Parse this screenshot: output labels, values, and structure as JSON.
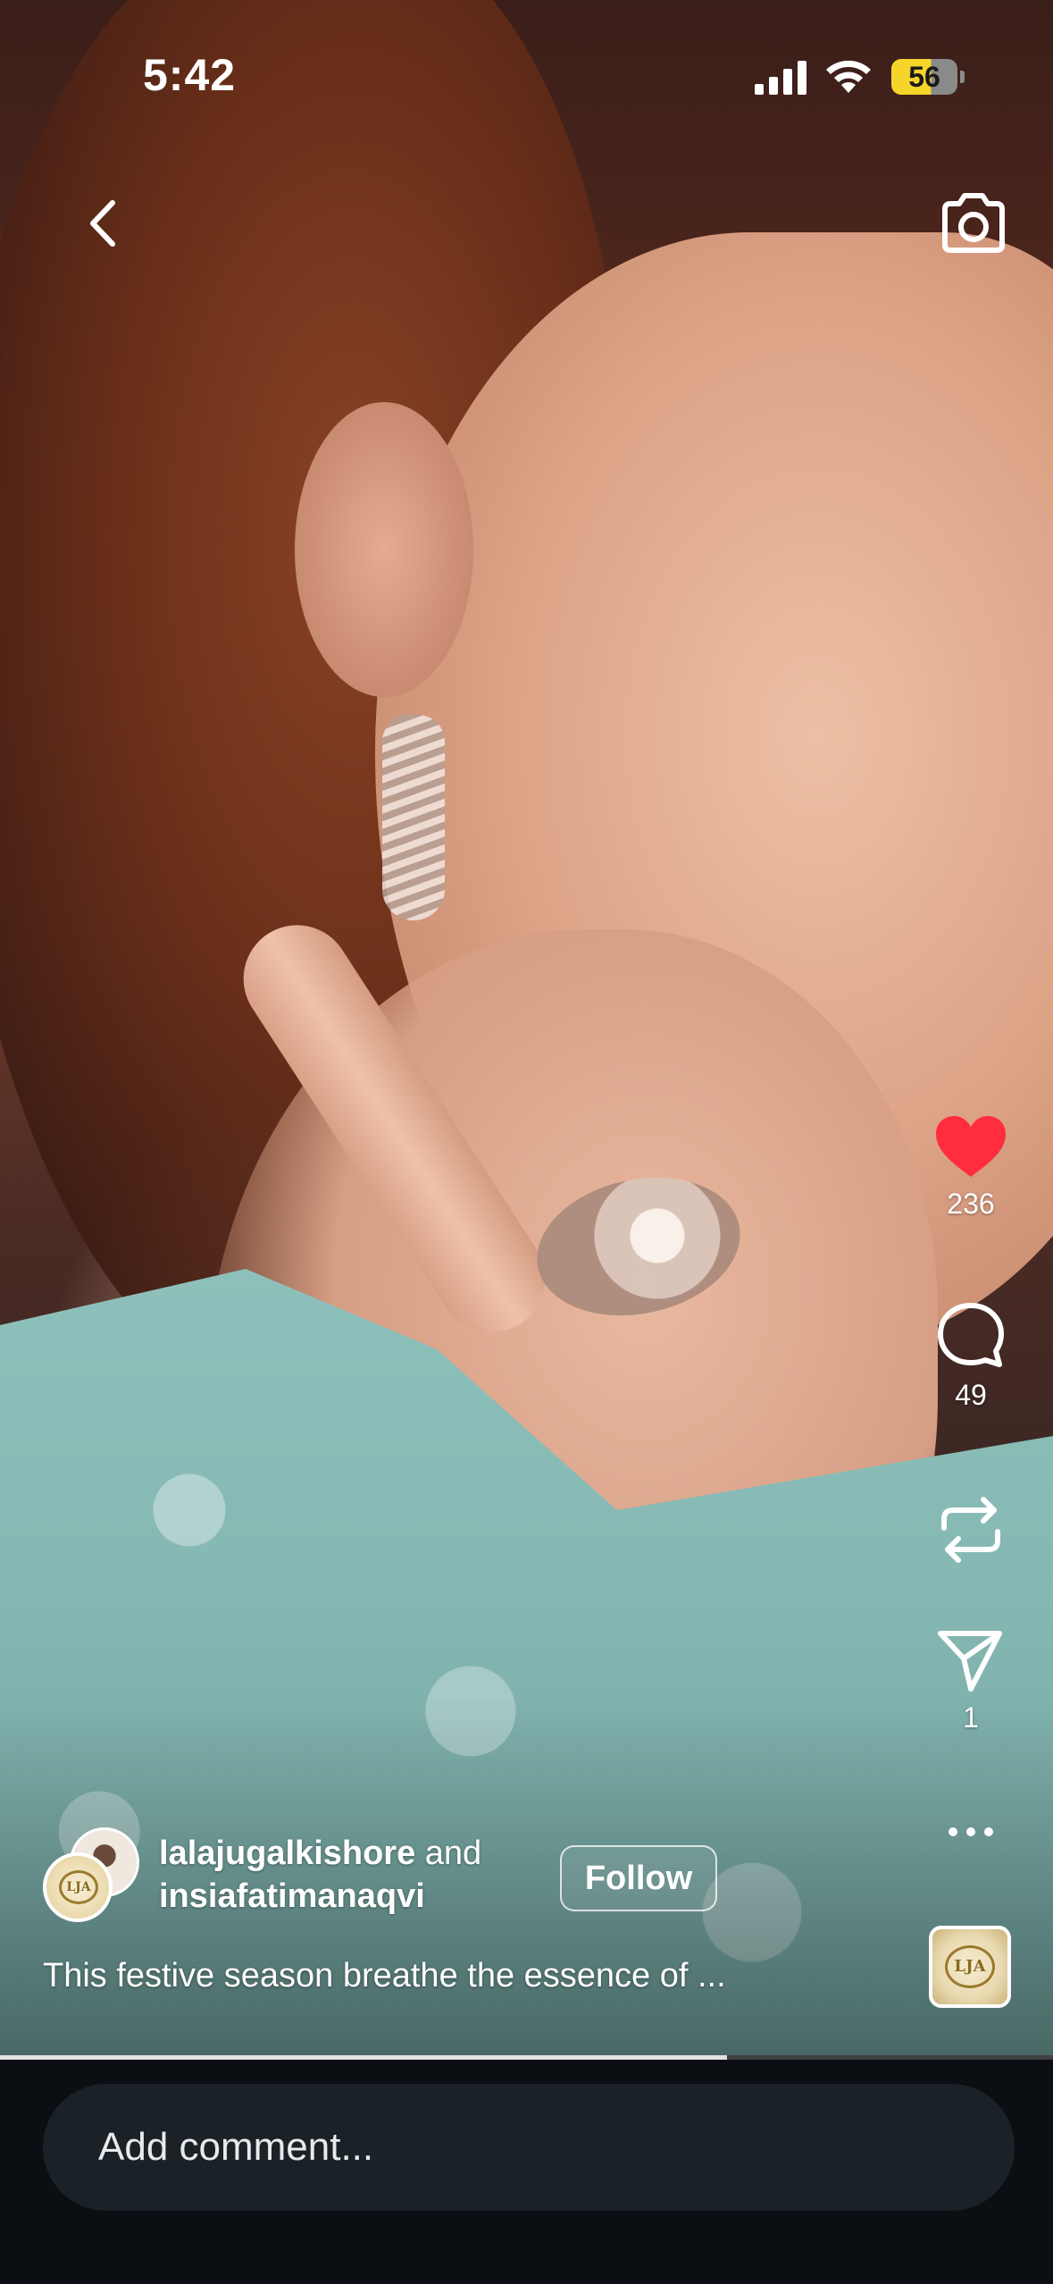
{
  "status_bar": {
    "time": "5:42",
    "battery_level": "56",
    "battery_color": "#f6d52b"
  },
  "top_bar": {
    "back_icon": "chevron-left-icon",
    "camera_icon": "camera-icon"
  },
  "actions": {
    "like": {
      "icon": "heart-filled-icon",
      "count": "236",
      "color": "#ff2d3d"
    },
    "comment": {
      "icon": "comment-bubble-icon",
      "count": "49"
    },
    "repost": {
      "icon": "repost-icon"
    },
    "share": {
      "icon": "paper-plane-icon",
      "count": "1"
    },
    "more": {
      "icon": "more-dots-icon"
    }
  },
  "audio": {
    "label": "LJA"
  },
  "post": {
    "author_primary": "lalajugalkishore",
    "author_conjunction": " and",
    "author_secondary": "insiafatimanaqvi",
    "follow_label": "Follow",
    "caption": "This festive season breathe the essence of ...",
    "avatar_label": "LJA"
  },
  "playback": {
    "progress": 0.69
  },
  "comment_bar": {
    "placeholder": "Add comment..."
  }
}
